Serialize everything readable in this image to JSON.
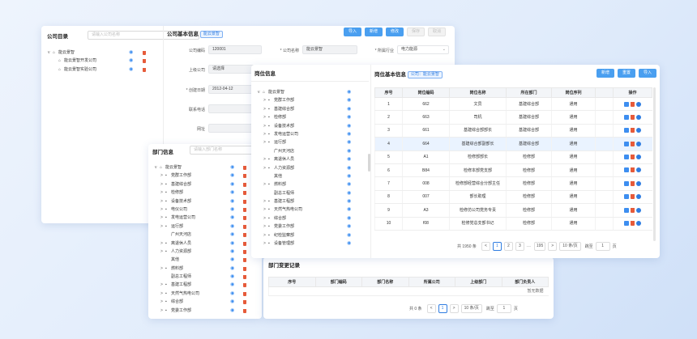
{
  "company_panel": {
    "title": "公司目录",
    "search_placeholder": "请输入公司名称",
    "tree": [
      {
        "label": "能云景智",
        "level": 0,
        "type": "home",
        "expanded": true
      },
      {
        "label": "能云景智开发公司",
        "level": 1,
        "type": "home"
      },
      {
        "label": "能云景智实验公司",
        "level": 1,
        "type": "home"
      }
    ]
  },
  "company_info": {
    "title": "公司基本信息",
    "tag": "能云景智",
    "buttons": [
      {
        "label": "导入",
        "enabled": true
      },
      {
        "label": "新增",
        "enabled": true
      },
      {
        "label": "修改",
        "enabled": true
      },
      {
        "label": "保存",
        "enabled": false
      },
      {
        "label": "取消",
        "enabled": false
      }
    ],
    "fields": {
      "code_label": "公司编码",
      "code_value": "120001",
      "name_label": "* 公司名称",
      "name_value": "能云景智",
      "industry_label": "* 所属行业",
      "industry_value": "电力能源",
      "parent_label": "上级公司",
      "parent_value": "请选择",
      "created_label": "* 创建日期",
      "created_value": "2012-04-12",
      "phone_label": "联系电话",
      "phone_value": "",
      "website_label": "网址",
      "website_value": ""
    }
  },
  "dept_panel": {
    "title": "部门信息",
    "search_placeholder": "请输入部门名称",
    "tree": [
      {
        "label": "能云景智",
        "level": 0,
        "type": "home",
        "arrow": "v"
      },
      {
        "label": "党群工作部",
        "level": 1,
        "type": "lock",
        "arrow": ">"
      },
      {
        "label": "基建综合部",
        "level": 1,
        "type": "lock",
        "arrow": ">"
      },
      {
        "label": "检修部",
        "level": 1,
        "type": "lock",
        "arrow": ">"
      },
      {
        "label": "设备技术部",
        "level": 1,
        "type": "lock",
        "arrow": ">"
      },
      {
        "label": "电仪公司",
        "level": 1,
        "type": "lock",
        "arrow": ">"
      },
      {
        "label": "发电运营公司",
        "level": 1,
        "type": "lock",
        "arrow": ">"
      },
      {
        "label": "运行部",
        "level": 1,
        "type": "lock",
        "arrow": ">"
      },
      {
        "label": "广州天河店",
        "level": 1,
        "type": "none",
        "arrow": ""
      },
      {
        "label": "离退休人员",
        "level": 1,
        "type": "lock",
        "arrow": ">"
      },
      {
        "label": "人力资源部",
        "level": 1,
        "type": "lock",
        "arrow": ">"
      },
      {
        "label": "其他",
        "level": 1,
        "type": "none",
        "arrow": ""
      },
      {
        "label": "燃料部",
        "level": 1,
        "type": "lock",
        "arrow": ">"
      },
      {
        "label": "副总工程师",
        "level": 1,
        "type": "none",
        "arrow": ""
      },
      {
        "label": "基建工程部",
        "level": 1,
        "type": "lock",
        "arrow": ">"
      },
      {
        "label": "天然气热电公司",
        "level": 1,
        "type": "lock",
        "arrow": ">"
      },
      {
        "label": "综合部",
        "level": 1,
        "type": "lock",
        "arrow": ">"
      },
      {
        "label": "党委工作部",
        "level": 1,
        "type": "lock",
        "arrow": ">"
      }
    ]
  },
  "post_panel": {
    "title": "岗位信息",
    "tree": [
      {
        "label": "能云景智",
        "level": 0,
        "type": "home",
        "arrow": "v"
      },
      {
        "label": "党群工作部",
        "level": 1,
        "type": "lock",
        "arrow": ">"
      },
      {
        "label": "基建综合部",
        "level": 1,
        "type": "lock",
        "arrow": ">"
      },
      {
        "label": "检修部",
        "level": 1,
        "type": "lock",
        "arrow": ">"
      },
      {
        "label": "设备技术部",
        "level": 1,
        "type": "lock",
        "arrow": ">"
      },
      {
        "label": "发电运营公司",
        "level": 1,
        "type": "lock",
        "arrow": ">"
      },
      {
        "label": "运行部",
        "level": 1,
        "type": "lock",
        "arrow": ">"
      },
      {
        "label": "广州天河店",
        "level": 1,
        "type": "none",
        "arrow": ""
      },
      {
        "label": "离退休人员",
        "level": 1,
        "type": "lock",
        "arrow": ">"
      },
      {
        "label": "人力资源部",
        "level": 1,
        "type": "lock",
        "arrow": ">"
      },
      {
        "label": "其他",
        "level": 1,
        "type": "none",
        "arrow": ""
      },
      {
        "label": "燃料部",
        "level": 1,
        "type": "lock",
        "arrow": ">"
      },
      {
        "label": "副总工程师",
        "level": 1,
        "type": "none",
        "arrow": ""
      },
      {
        "label": "基建工程部",
        "level": 1,
        "type": "lock",
        "arrow": ">"
      },
      {
        "label": "天然气热电公司",
        "level": 1,
        "type": "lock",
        "arrow": ">"
      },
      {
        "label": "综合部",
        "level": 1,
        "type": "lock",
        "arrow": ">"
      },
      {
        "label": "党委工作部",
        "level": 1,
        "type": "lock",
        "arrow": ">"
      },
      {
        "label": "纪检监察部",
        "level": 1,
        "type": "lock",
        "arrow": ">"
      },
      {
        "label": "设备管理部",
        "level": 1,
        "type": "lock",
        "arrow": ">"
      }
    ]
  },
  "post_info": {
    "title": "岗位基本信息",
    "tag": "公司：能云景智",
    "buttons": [
      {
        "label": "新增"
      },
      {
        "label": "重置"
      },
      {
        "label": "导入"
      }
    ],
    "columns": [
      "序号",
      "岗位编码",
      "岗位名称",
      "所在部门",
      "岗位序列",
      "",
      "操作"
    ],
    "rows": [
      [
        "1",
        "662",
        "文员",
        "基建综合部",
        "通用",
        ""
      ],
      [
        "2",
        "663",
        "司机",
        "基建综合部",
        "通用",
        ""
      ],
      [
        "3",
        "661",
        "基建综合部部长",
        "基建综合部",
        "通用",
        ""
      ],
      [
        "4",
        "664",
        "基建综合部副部长",
        "基建综合部",
        "通用",
        ""
      ],
      [
        "5",
        "A1",
        "检修部部长",
        "检修部",
        "通用",
        ""
      ],
      [
        "6",
        "B84",
        "检修本部党支部",
        "检修部",
        "通用",
        ""
      ],
      [
        "7",
        "008",
        "检修部经营综合分部主任",
        "检修部",
        "通用",
        ""
      ],
      [
        "8",
        "007",
        "部长助理",
        "检修部",
        "通用",
        ""
      ],
      [
        "9",
        "A3",
        "检修仿公司党务专责",
        "检修部",
        "通用",
        ""
      ],
      [
        "10",
        "f08",
        "检修党总支部书记",
        "检修部",
        "通用",
        ""
      ]
    ],
    "selected_row": 3,
    "pagination": {
      "total": "共 1950 条",
      "pages": [
        "1",
        "2",
        "3",
        "···",
        "195"
      ],
      "prev": "<",
      "next": ">",
      "page_size": "10 条/页",
      "goto_label": "跳至",
      "goto_value": "1",
      "page_suffix": "页"
    }
  },
  "dept_change": {
    "title": "部门变更记录",
    "columns": [
      "序号",
      "部门编码",
      "部门名称",
      "所属公司",
      "上级部门",
      "部门负责人"
    ],
    "empty_text": "暂无数据",
    "pagination": {
      "total": "共 0 条",
      "current": "1",
      "prev": "<",
      "next": ">",
      "page_size": "10 条/页",
      "goto_label": "跳至",
      "goto_value": "1",
      "page_suffix": "页"
    }
  },
  "icons": {
    "expand": "v",
    "collapse": ">",
    "eye": "◉"
  },
  "colors": {
    "primary": "#4a9ff0",
    "delete": "#e65b3a",
    "info": "#2f7de1"
  }
}
